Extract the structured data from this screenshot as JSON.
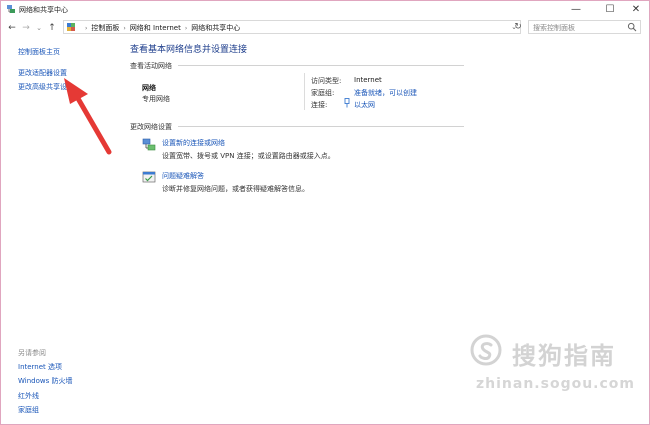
{
  "window": {
    "title": "网络和共享中心",
    "min_glyph": "—",
    "max_glyph": "☐",
    "close_glyph": "✕"
  },
  "address": {
    "back_glyph": "←",
    "forward_glyph": "→",
    "history_glyph": "⌄",
    "up_glyph": "↑",
    "crumbs": [
      "控制面板",
      "网络和 Internet",
      "网络和共享中心"
    ],
    "crumb_sep": "›",
    "dropdown_glyph": "⌄",
    "refresh_glyph": "↻",
    "search_placeholder": "搜索控制面板"
  },
  "sidebar": {
    "items": [
      {
        "label": "控制面板主页"
      },
      {
        "label": "更改适配器设置"
      },
      {
        "label": "更改高级共享设"
      }
    ],
    "see_also_title": "另请参阅",
    "see_also": [
      {
        "label": "Internet 选项"
      },
      {
        "label": "Windows 防火墙"
      },
      {
        "label": "红外线"
      },
      {
        "label": "家庭组"
      }
    ]
  },
  "main": {
    "title": "查看基本网络信息并设置连接",
    "active_networks_label": "查看活动网络",
    "network": {
      "name": "网络",
      "type": "专用网络",
      "access_type_label": "访问类型:",
      "access_type_value": "Internet",
      "homegroup_label": "家庭组:",
      "homegroup_value": "准备就绪，可以创建",
      "connections_label": "连接:",
      "connection_value": "以太网"
    },
    "change_settings_label": "更改网络设置",
    "tasks": [
      {
        "icon": "network-setup-icon",
        "title": "设置新的连接或网络",
        "desc": "设置宽带、拨号或 VPN 连接；或设置路由器或接入点。"
      },
      {
        "icon": "troubleshoot-icon",
        "title": "问题疑难解答",
        "desc": "诊断并修复网络问题，或者获得疑难解答信息。"
      }
    ]
  },
  "watermark": {
    "brand": "搜狗指南",
    "url": "zhinan.sogou.com"
  },
  "colors": {
    "link": "#1a56b8",
    "title": "#1e3e8c",
    "frame": "#e0a6bf",
    "arrow": "#e53935"
  }
}
